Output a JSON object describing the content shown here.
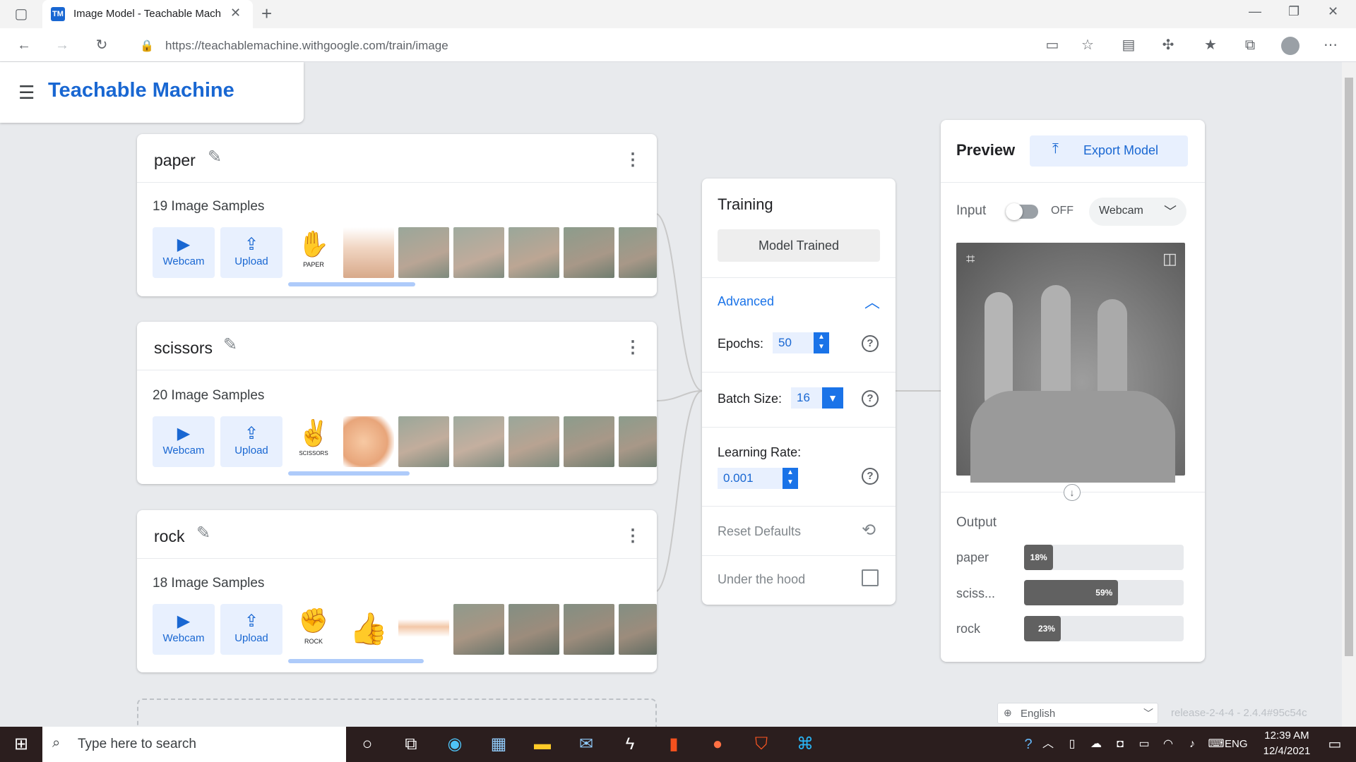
{
  "browser": {
    "tab_title": "Image Model - Teachable Machi",
    "tab_favicon": "TM",
    "url": "https://teachablemachine.withgoogle.com/train/image"
  },
  "app": {
    "title": "Teachable Machine"
  },
  "classes": [
    {
      "name": "paper",
      "samples": "19 Image Samples",
      "webcam_label": "Webcam",
      "upload_label": "Upload",
      "thumb_caption": "PAPER"
    },
    {
      "name": "scissors",
      "samples": "20 Image Samples",
      "webcam_label": "Webcam",
      "upload_label": "Upload",
      "thumb_caption": "SCISSORS"
    },
    {
      "name": "rock",
      "samples": "18 Image Samples",
      "webcam_label": "Webcam",
      "upload_label": "Upload",
      "thumb_caption": "ROCK"
    }
  ],
  "training": {
    "title": "Training",
    "status_button": "Model Trained",
    "advanced_label": "Advanced",
    "epochs_label": "Epochs:",
    "epochs_value": "50",
    "batch_label": "Batch Size:",
    "batch_value": "16",
    "lr_label": "Learning Rate:",
    "lr_value": "0.001",
    "reset_label": "Reset Defaults",
    "hood_label": "Under the hood"
  },
  "preview": {
    "title": "Preview",
    "export_label": "Export Model",
    "input_label": "Input",
    "toggle_state": "OFF",
    "source_label": "Webcam",
    "output_label": "Output",
    "outputs": [
      {
        "label": "paper",
        "percent_text": "18%",
        "fraction": 0.18
      },
      {
        "label": "sciss...",
        "percent_text": "59%",
        "fraction": 0.59
      },
      {
        "label": "rock",
        "percent_text": "23%",
        "fraction": 0.23
      }
    ]
  },
  "footer": {
    "language": "English",
    "release": "release-2-4-4 - 2.4.4#95c54c"
  },
  "taskbar": {
    "search_placeholder": "Type here to search",
    "lang": "ENG",
    "time": "12:39 AM",
    "date": "12/4/2021"
  },
  "colors": {
    "brand": "#1967d2",
    "accent": "#1a73e8",
    "light_blue": "#e8f0fe"
  }
}
